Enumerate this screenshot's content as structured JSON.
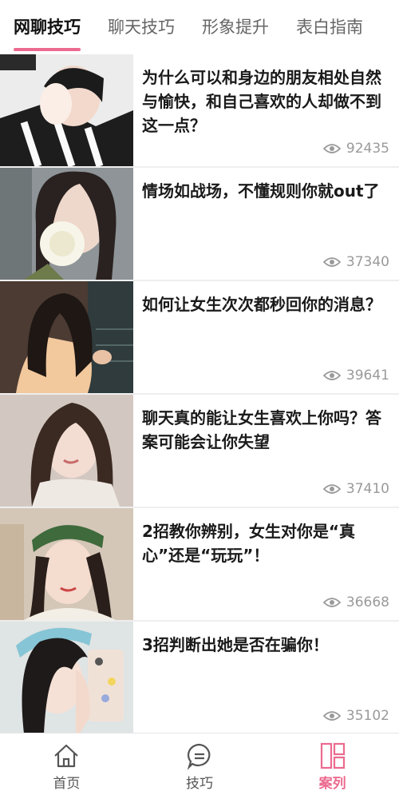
{
  "tabs": [
    {
      "label": "网聊技巧"
    },
    {
      "label": "聊天技巧"
    },
    {
      "label": "形象提升"
    },
    {
      "label": "表白指南"
    }
  ],
  "articles": [
    {
      "title": "为什么可以和身边的朋友相处自然与愉快，和自己喜欢的人却做不到这一点？",
      "views": "92435"
    },
    {
      "title": "情场如战场，不懂规则你就out了",
      "views": "37340"
    },
    {
      "title": "如何让女生次次都秒回你的消息？",
      "views": "39641"
    },
    {
      "title": "聊天真的能让女生喜欢上你吗？答案可能会让你失望",
      "views": "37410"
    },
    {
      "title": "2招教你辨别，女生对你是“真心”还是“玩玩”！",
      "views": "36668"
    },
    {
      "title": "3招判断出她是否在骗你！",
      "views": "35102"
    }
  ],
  "bottom_nav": {
    "home": "首页",
    "tips": "技巧",
    "cases": "案列"
  },
  "colors": {
    "accent": "#ec6a8f",
    "views": "#9a9a9a"
  }
}
